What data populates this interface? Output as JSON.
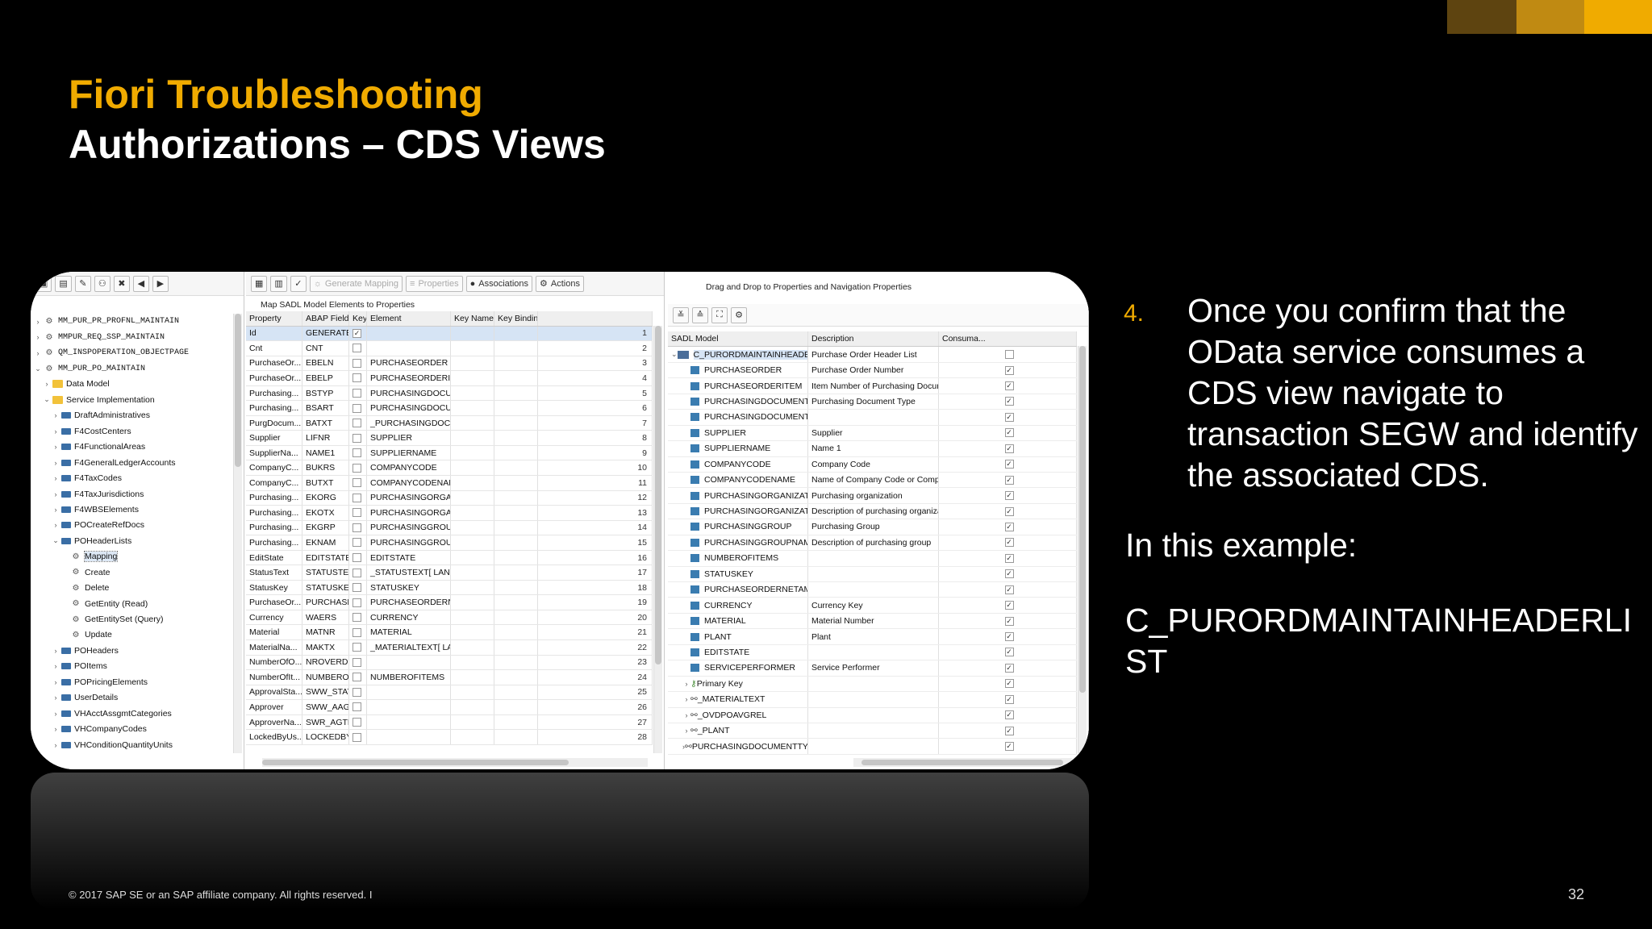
{
  "colors": {
    "accent": "#f0ab00",
    "background": "#000000"
  },
  "title": "Fiori Troubleshooting",
  "subtitle": "Authorizations – CDS Views",
  "tree": [
    {
      "label": "MM_PUR_PR_PROFNL_MAINTAIN",
      "indent": 0,
      "chev": "›",
      "icon": "gear",
      "mono": true
    },
    {
      "label": "MMPUR_REQ_SSP_MAINTAIN",
      "indent": 0,
      "chev": "›",
      "icon": "gear",
      "mono": true
    },
    {
      "label": "QM_INSPOPERATION_OBJECTPAGE",
      "indent": 0,
      "chev": "›",
      "icon": "gear",
      "mono": true
    },
    {
      "label": "MM_PUR_PO_MAINTAIN",
      "indent": 0,
      "chev": "⌄",
      "icon": "gear",
      "mono": true
    },
    {
      "label": "Data Model",
      "indent": 1,
      "chev": "›",
      "icon": "folder"
    },
    {
      "label": "Service Implementation",
      "indent": 1,
      "chev": "⌄",
      "icon": "folder"
    },
    {
      "label": "DraftAdministratives",
      "indent": 2,
      "chev": "›",
      "icon": "node"
    },
    {
      "label": "F4CostCenters",
      "indent": 2,
      "chev": "›",
      "icon": "node"
    },
    {
      "label": "F4FunctionalAreas",
      "indent": 2,
      "chev": "›",
      "icon": "node"
    },
    {
      "label": "F4GeneralLedgerAccounts",
      "indent": 2,
      "chev": "›",
      "icon": "node"
    },
    {
      "label": "F4TaxCodes",
      "indent": 2,
      "chev": "›",
      "icon": "node"
    },
    {
      "label": "F4TaxJurisdictions",
      "indent": 2,
      "chev": "›",
      "icon": "node"
    },
    {
      "label": "F4WBSElements",
      "indent": 2,
      "chev": "›",
      "icon": "node"
    },
    {
      "label": "POCreateRefDocs",
      "indent": 2,
      "chev": "›",
      "icon": "node"
    },
    {
      "label": "POHeaderLists",
      "indent": 2,
      "chev": "⌄",
      "icon": "node"
    },
    {
      "label": "Mapping",
      "indent": 3,
      "chev": "",
      "icon": "gear",
      "selected": true
    },
    {
      "label": "Create",
      "indent": 3,
      "chev": "",
      "icon": "gear"
    },
    {
      "label": "Delete",
      "indent": 3,
      "chev": "",
      "icon": "gear"
    },
    {
      "label": "GetEntity (Read)",
      "indent": 3,
      "chev": "",
      "icon": "gear"
    },
    {
      "label": "GetEntitySet (Query)",
      "indent": 3,
      "chev": "",
      "icon": "gear"
    },
    {
      "label": "Update",
      "indent": 3,
      "chev": "",
      "icon": "gear"
    },
    {
      "label": "POHeaders",
      "indent": 2,
      "chev": "›",
      "icon": "node"
    },
    {
      "label": "POItems",
      "indent": 2,
      "chev": "›",
      "icon": "node"
    },
    {
      "label": "POPricingElements",
      "indent": 2,
      "chev": "›",
      "icon": "node"
    },
    {
      "label": "UserDetails",
      "indent": 2,
      "chev": "›",
      "icon": "node"
    },
    {
      "label": "VHAcctAssgmtCategories",
      "indent": 2,
      "chev": "›",
      "icon": "node"
    },
    {
      "label": "VHCompanyCodes",
      "indent": 2,
      "chev": "›",
      "icon": "node"
    },
    {
      "label": "VHConditionQuantityUnits",
      "indent": 2,
      "chev": "›",
      "icon": "node"
    }
  ],
  "mapping": {
    "toolbar": {
      "generate": "Generate Mapping",
      "properties": "Properties",
      "associations": "Associations",
      "actions": "Actions"
    },
    "caption": "Map SADL Model Elements to Properties",
    "headers": [
      "Property",
      "ABAP Field ...",
      "Key",
      "Element",
      "Key Name",
      "Key Binding"
    ],
    "rows": [
      {
        "p": "Id",
        "f": "GENERATED...",
        "k": true,
        "e": "",
        "n": "1",
        "sel": true
      },
      {
        "p": "Cnt",
        "f": "CNT",
        "k": false,
        "e": "",
        "n": "2"
      },
      {
        "p": "PurchaseOr...",
        "f": "EBELN",
        "k": false,
        "e": "PURCHASEORDER",
        "n": "3"
      },
      {
        "p": "PurchaseOr...",
        "f": "EBELP",
        "k": false,
        "e": "PURCHASEORDERITEM",
        "n": "4"
      },
      {
        "p": "Purchasing...",
        "f": "BSTYP",
        "k": false,
        "e": "PURCHASINGDOCUMENT...",
        "n": "5"
      },
      {
        "p": "Purchasing...",
        "f": "BSART",
        "k": false,
        "e": "PURCHASINGDOCUMENT...",
        "n": "6"
      },
      {
        "p": "PurgDocum...",
        "f": "BATXT",
        "k": false,
        "e": "_PURCHASINGDOCUMEN...",
        "n": "7"
      },
      {
        "p": "Supplier",
        "f": "LIFNR",
        "k": false,
        "e": "SUPPLIER",
        "n": "8"
      },
      {
        "p": "SupplierNa...",
        "f": "NAME1",
        "k": false,
        "e": "SUPPLIERNAME",
        "n": "9"
      },
      {
        "p": "CompanyC...",
        "f": "BUKRS",
        "k": false,
        "e": "COMPANYCODE",
        "n": "10"
      },
      {
        "p": "CompanyC...",
        "f": "BUTXT",
        "k": false,
        "e": "COMPANYCODENAME",
        "n": "11"
      },
      {
        "p": "Purchasing...",
        "f": "EKORG",
        "k": false,
        "e": "PURCHASINGORGANIZAT...",
        "n": "12"
      },
      {
        "p": "Purchasing...",
        "f": "EKOTX",
        "k": false,
        "e": "PURCHASINGORGANIZAT...",
        "n": "13"
      },
      {
        "p": "Purchasing...",
        "f": "EKGRP",
        "k": false,
        "e": "PURCHASINGGROUP",
        "n": "14"
      },
      {
        "p": "Purchasing...",
        "f": "EKNAM",
        "k": false,
        "e": "PURCHASINGGROUPNAME",
        "n": "15"
      },
      {
        "p": "EditState",
        "f": "EDITSTATE",
        "k": false,
        "e": "EDITSTATE",
        "n": "16"
      },
      {
        "p": "StatusText",
        "f": "STATUSTEXT",
        "k": false,
        "e": "_STATUSTEXT[ LANGUAG...",
        "n": "17"
      },
      {
        "p": "StatusKey",
        "f": "STATUSKEY",
        "k": false,
        "e": "STATUSKEY",
        "n": "18"
      },
      {
        "p": "PurchaseOr...",
        "f": "PURCHASEO...",
        "k": false,
        "e": "PURCHASEORDERNETAM...",
        "n": "19"
      },
      {
        "p": "Currency",
        "f": "WAERS",
        "k": false,
        "e": "CURRENCY",
        "n": "20"
      },
      {
        "p": "Material",
        "f": "MATNR",
        "k": false,
        "e": "MATERIAL",
        "n": "21"
      },
      {
        "p": "MaterialNa...",
        "f": "MAKTX",
        "k": false,
        "e": "_MATERIALTEXT[ LANGU...",
        "n": "22"
      },
      {
        "p": "NumberOfO...",
        "f": "NROVERDUE...",
        "k": false,
        "e": "",
        "n": "23"
      },
      {
        "p": "NumberOfIt...",
        "f": "NUMBEROFI...",
        "k": false,
        "e": "NUMBEROFITEMS",
        "n": "24"
      },
      {
        "p": "ApprovalSta...",
        "f": "SWW_STATX...",
        "k": false,
        "e": "",
        "n": "25"
      },
      {
        "p": "Approver",
        "f": "SWW_AAGE...",
        "k": false,
        "e": "",
        "n": "26"
      },
      {
        "p": "ApproverNa...",
        "f": "SWR_AGTN...",
        "k": false,
        "e": "",
        "n": "27"
      },
      {
        "p": "LockedByUs...",
        "f": "LOCKEDBYU...",
        "k": false,
        "e": "",
        "n": "28"
      }
    ]
  },
  "sadl": {
    "caption": "Drag and Drop to Properties and Navigation Properties",
    "headers": [
      "SADL Model",
      "Description",
      "Consuma..."
    ],
    "root": "C_PURORDMAINTAINHEADERSLIST",
    "root_desc": "Purchase Order Header List",
    "rows": [
      {
        "n": "PURCHASEORDER",
        "d": "Purchase Order Number",
        "t": "field"
      },
      {
        "n": "PURCHASEORDERITEM",
        "d": "Item Number of Purchasing Document",
        "t": "field"
      },
      {
        "n": "PURCHASINGDOCUMENTTYPE",
        "d": "Purchasing Document Type",
        "t": "field"
      },
      {
        "n": "PURCHASINGDOCUMENTCATEGORY",
        "d": "",
        "t": "field"
      },
      {
        "n": "SUPPLIER",
        "d": "Supplier",
        "t": "field"
      },
      {
        "n": "SUPPLIERNAME",
        "d": "Name 1",
        "t": "field"
      },
      {
        "n": "COMPANYCODE",
        "d": "Company Code",
        "t": "field"
      },
      {
        "n": "COMPANYCODENAME",
        "d": "Name of Company Code or Company",
        "t": "field"
      },
      {
        "n": "PURCHASINGORGANIZATION",
        "d": "Purchasing organization",
        "t": "field"
      },
      {
        "n": "PURCHASINGORGANIZATIONNAME",
        "d": "Description of purchasing organization",
        "t": "field"
      },
      {
        "n": "PURCHASINGGROUP",
        "d": "Purchasing Group",
        "t": "field"
      },
      {
        "n": "PURCHASINGGROUPNAME",
        "d": "Description of purchasing group",
        "t": "field"
      },
      {
        "n": "NUMBEROFITEMS",
        "d": "",
        "t": "field"
      },
      {
        "n": "STATUSKEY",
        "d": "",
        "t": "field"
      },
      {
        "n": "PURCHASEORDERNETAMOUNT",
        "d": "",
        "t": "field"
      },
      {
        "n": "CURRENCY",
        "d": "Currency Key",
        "t": "field"
      },
      {
        "n": "MATERIAL",
        "d": "Material Number",
        "t": "field"
      },
      {
        "n": "PLANT",
        "d": "Plant",
        "t": "field"
      },
      {
        "n": "EDITSTATE",
        "d": "",
        "t": "field"
      },
      {
        "n": "SERVICEPERFORMER",
        "d": "Service Performer",
        "t": "field"
      },
      {
        "n": "Primary Key",
        "d": "",
        "t": "key"
      },
      {
        "n": "_MATERIALTEXT",
        "d": "",
        "t": "assoc"
      },
      {
        "n": "_OVDPOAVGREL",
        "d": "",
        "t": "assoc"
      },
      {
        "n": "_PLANT",
        "d": "",
        "t": "assoc"
      },
      {
        "n": "PURCHASINGDOCUMENTTYPETEXT",
        "d": "",
        "t": "assoc"
      }
    ]
  },
  "bullet": {
    "number": "4.",
    "text": "Once you confirm that the OData service consumes a CDS view navigate to transaction SEGW and identify the associated CDS."
  },
  "example_label": "In this example:",
  "cds_name": "C_PURORDMAINTAINHEADERLIST",
  "footer": "© 2017 SAP SE or an SAP affiliate company. All rights reserved.  I",
  "page_number": "32"
}
